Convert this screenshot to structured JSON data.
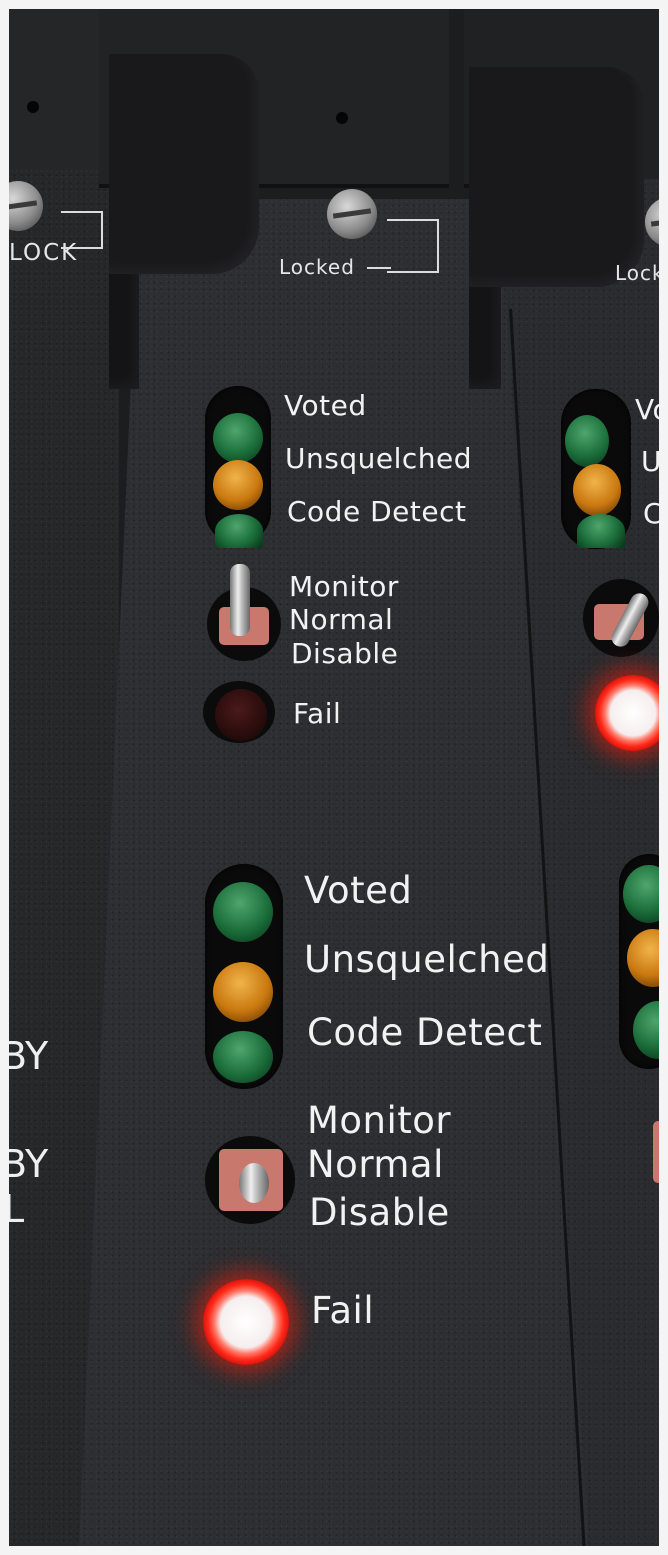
{
  "image": {
    "subject": "rack-mounted radio receiver voting modules",
    "colors": {
      "panel": "#2d2e31",
      "led_green": "#1b6e3a",
      "led_amber": "#c9780f",
      "led_red": "#ff2a1a",
      "text": "#f2f2f2"
    }
  },
  "left_module": {
    "lock_label": "LOCK",
    "text_1": "BY",
    "text_2": "BY",
    "text_3": "L"
  },
  "center_module": {
    "lock_label": "Locked",
    "upper_group": {
      "voted": "Voted",
      "unsquelched": "Unsquelched",
      "code_detect": "Code Detect",
      "monitor": "Monitor",
      "normal": "Normal",
      "disable": "Disable",
      "fail": "Fail",
      "fail_led_lit": false
    },
    "lower_group": {
      "voted": "Voted",
      "unsquelched": "Unsquelched",
      "code_detect": "Code Detect",
      "monitor": "Monitor",
      "normal": "Normal",
      "disable": "Disable",
      "fail": "Fail",
      "fail_led_lit": true
    }
  },
  "right_module": {
    "lock_label": "Lock",
    "text_vo": "Vo",
    "text_u": "U",
    "text_c": "C",
    "fail_led_lit": true
  }
}
